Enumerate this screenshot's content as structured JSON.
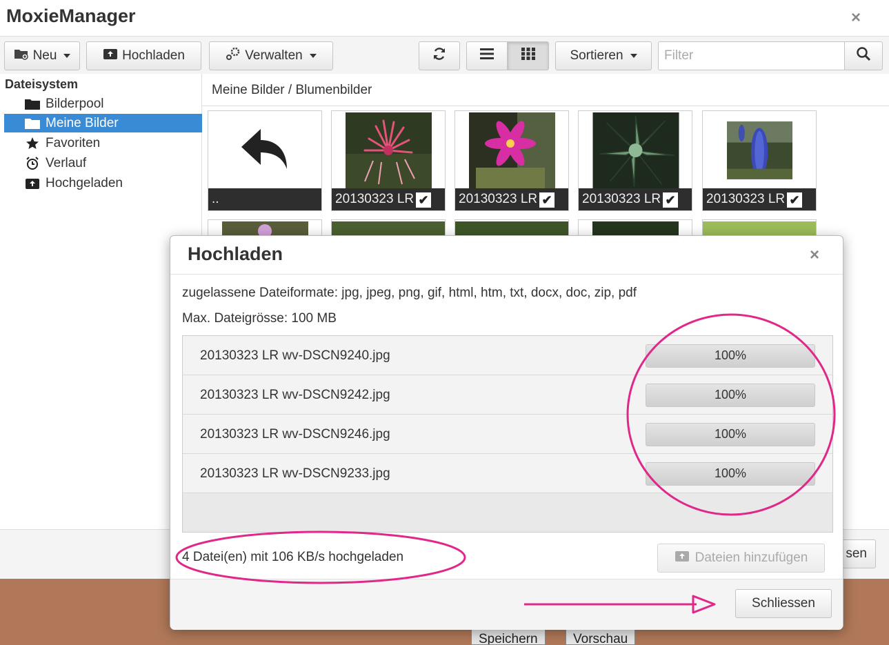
{
  "app": {
    "title": "MoxieManager",
    "close_symbol": "×"
  },
  "toolbar": {
    "new_label": "Neu",
    "upload_label": "Hochladen",
    "manage_label": "Verwalten",
    "sort_label": "Sortieren",
    "filter_placeholder": "Filter",
    "refresh_icon": "refresh-icon",
    "list_view_icon": "list-view-icon",
    "grid_view_icon": "grid-view-icon",
    "search_icon": "search-icon"
  },
  "sidebar": {
    "title": "Dateisystem",
    "items": [
      {
        "label": "Bilderpool",
        "icon": "folder-icon",
        "selected": false
      },
      {
        "label": "Meine Bilder",
        "icon": "folder-icon",
        "selected": true
      },
      {
        "label": "Favoriten",
        "icon": "star-icon",
        "selected": false
      },
      {
        "label": "Verlauf",
        "icon": "alarm-clock-icon",
        "selected": false
      },
      {
        "label": "Hochgeladen",
        "icon": "upload-box-icon",
        "selected": false
      }
    ]
  },
  "content": {
    "breadcrumb": "Meine Bilder / Blumenbilder",
    "back_tile_label": "..",
    "tiles": [
      {
        "label": "20130323 LR",
        "image": "red-spiky-flower"
      },
      {
        "label": "20130323 LR",
        "image": "magenta-cactus-flower"
      },
      {
        "label": "20130323 LR",
        "image": "green-succulent-rosette"
      },
      {
        "label": "20130323 LR",
        "image": "blue-flower-spike"
      }
    ]
  },
  "main_footer": {
    "partial_button_label": "sen"
  },
  "page": {
    "save_label": "Speichern",
    "preview_label": "Vorschau"
  },
  "upload_dialog": {
    "title": "Hochladen",
    "close_symbol": "×",
    "allowed_formats": "zugelassene Dateiformate: jpg, jpeg, png, gif, html, htm, txt, docx, doc, zip, pdf",
    "max_size": "Max. Dateigrösse: 100 MB",
    "files": [
      {
        "name": "20130323 LR wv-DSCN9240.jpg",
        "progress": 100,
        "progress_label": "100%"
      },
      {
        "name": "20130323 LR wv-DSCN9242.jpg",
        "progress": 100,
        "progress_label": "100%"
      },
      {
        "name": "20130323 LR wv-DSCN9246.jpg",
        "progress": 100,
        "progress_label": "100%"
      },
      {
        "name": "20130323 LR wv-DSCN9233.jpg",
        "progress": 100,
        "progress_label": "100%"
      }
    ],
    "status": "4 Datei(en) mit 106 KB/s hochgeladen",
    "add_files_label": "Dateien hinzufügen",
    "close_label": "Schliessen"
  },
  "colors": {
    "selection_blue": "#3a8bd6",
    "annotation_magenta": "#e0288a",
    "page_background_brown": "#b07858"
  }
}
